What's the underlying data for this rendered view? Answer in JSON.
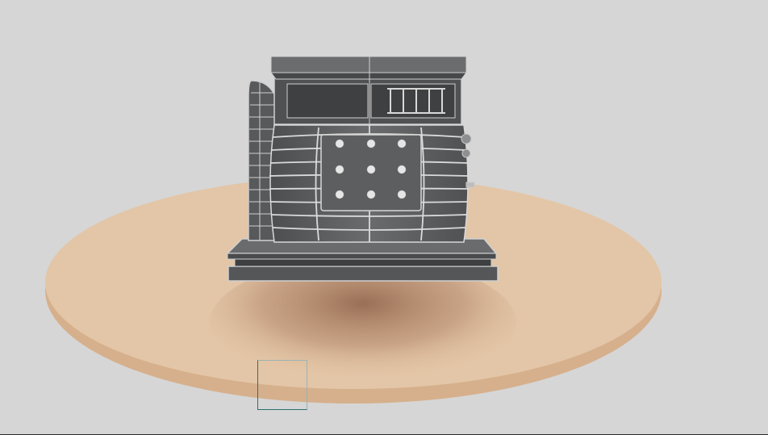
{
  "scene": {
    "subject": "cash-register-wireframe-render",
    "colors": {
      "background": "#d6d6d6",
      "turntable_top": "#e2c4a4",
      "turntable_side": "#d9b592",
      "shadow": "#b28565",
      "model_body": "#5f6062",
      "model_dark": "#47484a",
      "model_lines": "#dcdcdc",
      "selection_box": "#2f6f6f"
    }
  }
}
